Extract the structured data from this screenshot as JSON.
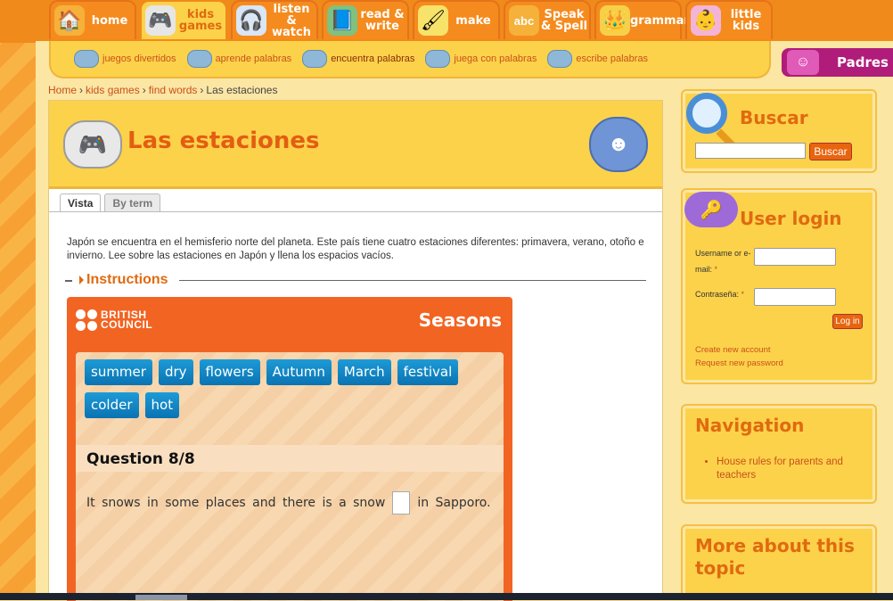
{
  "topnav": [
    {
      "label": "home",
      "icon": "house-icon",
      "active": false
    },
    {
      "label": "kids games",
      "icon": "gamepad-icon",
      "active": true
    },
    {
      "label": "listen & watch",
      "icon": "mp3-player-icon",
      "active": false
    },
    {
      "label": "read & write",
      "icon": "book-pencil-icon",
      "active": false
    },
    {
      "label": "make",
      "icon": "paint-jar-icon",
      "active": false
    },
    {
      "label": "Speak & Spell",
      "icon": "abc-icon",
      "active": false
    },
    {
      "label": "grammar",
      "icon": "crown-icon",
      "active": false
    },
    {
      "label": "little kids",
      "icon": "baby-icon",
      "active": false
    }
  ],
  "subnav": [
    {
      "label": "juegos divertidos"
    },
    {
      "label": "aprende palabras"
    },
    {
      "label": "encuentra palabras"
    },
    {
      "label": "juega con palabras"
    },
    {
      "label": "escribe palabras"
    }
  ],
  "padres": {
    "label": "Padres"
  },
  "breadcrumb": {
    "home": "Home",
    "kids_games": "kids games",
    "find_words": "find words",
    "current": "Las estaciones"
  },
  "main": {
    "title": "Las estaciones",
    "tabs": [
      "Vista",
      "By term"
    ],
    "intro": "Japón se encuentra en el hemisferio norte del planeta. Este país tiene cuatro estaciones diferentes: primavera, verano, otoño e invierno. Lee sobre las estaciones en Japón y llena los espacios vacíos.",
    "instructions_label": "Instructions"
  },
  "game": {
    "brand_line1": "BRITISH",
    "brand_line2": "COUNCIL",
    "title": "Seasons",
    "words": [
      "summer",
      "dry",
      "flowers",
      "Autumn",
      "March",
      "festival",
      "colder",
      "hot"
    ],
    "question_label": "Question 8/8",
    "question_before": "It snows in some places and there is a snow",
    "question_after": "in Sapporo."
  },
  "search": {
    "title": "Buscar",
    "button": "Buscar"
  },
  "login": {
    "title": "User login",
    "username_label": "Username or e-mail:",
    "password_label": "Contraseña:",
    "required_mark": "*",
    "button": "Log in",
    "create_account": "Create new account",
    "request_password": "Request new password"
  },
  "navigation": {
    "title": "Navigation",
    "items": [
      "House rules for parents and teachers"
    ]
  },
  "more": {
    "title": "More about this topic"
  },
  "colors": {
    "accent": "#f26422",
    "brand_orange": "#e06a10",
    "word_blue": "#1d9bd6",
    "panel_yellow": "#fcd24a"
  }
}
